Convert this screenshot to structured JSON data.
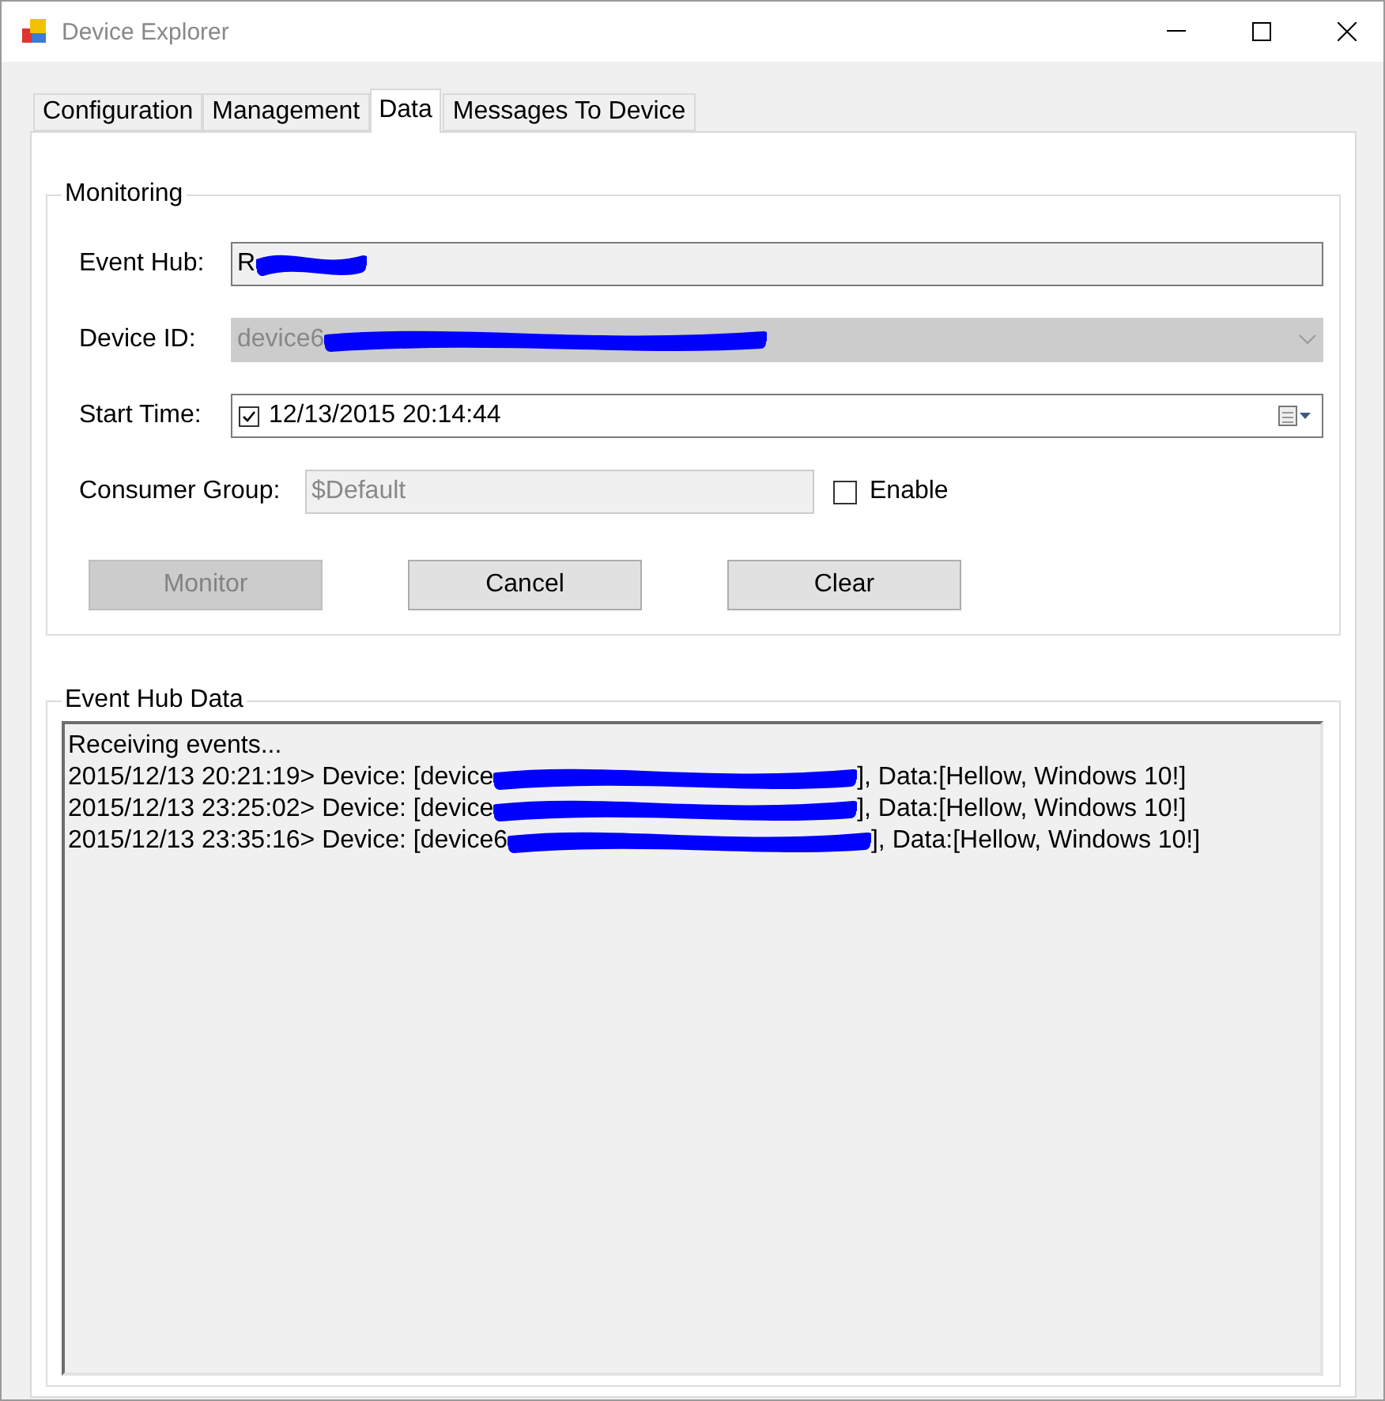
{
  "window": {
    "title": "Device Explorer"
  },
  "tabs": [
    {
      "label": "Configuration",
      "selected": false
    },
    {
      "label": "Management",
      "selected": false
    },
    {
      "label": "Data",
      "selected": true
    },
    {
      "label": "Messages To Device",
      "selected": false
    }
  ],
  "monitoring": {
    "title": "Monitoring",
    "event_hub": {
      "label": "Event Hub:",
      "value": "R"
    },
    "device_id": {
      "label": "Device ID:",
      "value": "device6",
      "disabled": true
    },
    "start_time": {
      "label": "Start Time:",
      "value": "12/13/2015 20:14:44",
      "checked": true
    },
    "consumer_group": {
      "label": "Consumer Group:",
      "value": "$Default",
      "disabled": true
    },
    "enable": {
      "label": "Enable",
      "checked": false
    },
    "buttons": [
      {
        "label": "Monitor",
        "disabled": true
      },
      {
        "label": "Cancel",
        "disabled": false
      },
      {
        "label": "Clear",
        "disabled": false
      }
    ]
  },
  "event_hub_data": {
    "title": "Event Hub Data",
    "header": "Receiving events...",
    "lines": [
      {
        "prefix": "2015/12/13 20:21:19> Device: [device",
        "suffix": "], Data:[Hellow, Windows 10!]"
      },
      {
        "prefix": "2015/12/13 23:25:02> Device: [device",
        "suffix": "], Data:[Hellow, Windows 10!]"
      },
      {
        "prefix": "2015/12/13 23:35:16> Device: [device6",
        "suffix": "], Data:[Hellow, Windows 10!]"
      }
    ]
  }
}
